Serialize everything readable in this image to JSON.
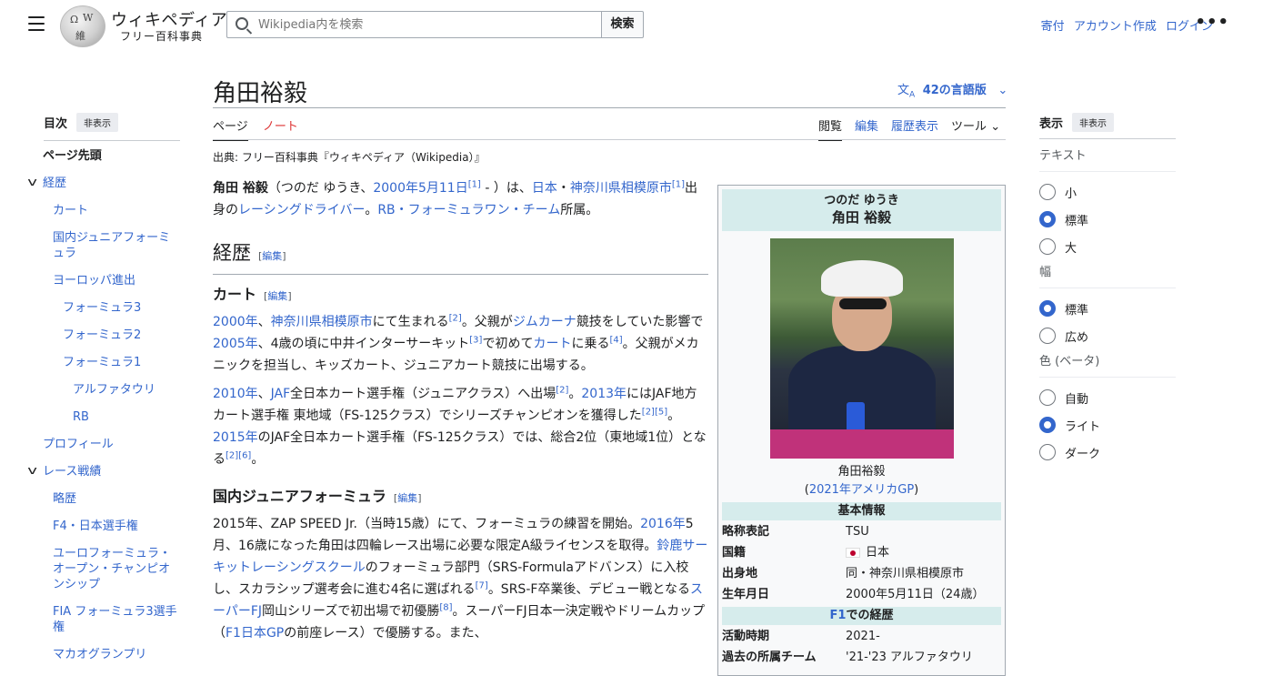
{
  "header": {
    "site_title": "ウィキペディア",
    "site_tagline": "フリー百科事典",
    "search_placeholder": "Wikipedia内を検索",
    "search_button": "検索",
    "links": [
      "寄付",
      "アカウント作成",
      "ログイン"
    ],
    "more": "•••"
  },
  "toc": {
    "title": "目次",
    "hide": "非表示",
    "items": [
      {
        "label": "ページ先頭",
        "level": 0,
        "top": true
      },
      {
        "label": "経歴",
        "level": 0,
        "chevron": true
      },
      {
        "label": "カート",
        "level": 1
      },
      {
        "label": "国内ジュニアフォーミュラ",
        "level": 1
      },
      {
        "label": "ヨーロッパ進出",
        "level": 1
      },
      {
        "label": "フォーミュラ3",
        "level": 2
      },
      {
        "label": "フォーミュラ2",
        "level": 2
      },
      {
        "label": "フォーミュラ1",
        "level": 2
      },
      {
        "label": "アルファタウリ",
        "level": 3
      },
      {
        "label": "RB",
        "level": 3
      },
      {
        "label": "プロフィール",
        "level": 0
      },
      {
        "label": "レース戦績",
        "level": 0,
        "chevron": true
      },
      {
        "label": "略歴",
        "level": 1
      },
      {
        "label": "F4・日本選手権",
        "level": 1
      },
      {
        "label": "ユーロフォーミュラ・オープン・チャンピオンシップ",
        "level": 1
      },
      {
        "label": "FIA フォーミュラ3選手権",
        "level": 1
      },
      {
        "label": "マカオグランプリ",
        "level": 1
      }
    ]
  },
  "page": {
    "title": "角田裕毅",
    "languages": "42の言語版",
    "tab_page": "ページ",
    "tab_talk": "ノート",
    "tab_read": "閲覧",
    "tab_edit": "編集",
    "tab_history": "履歴表示",
    "tab_tools": "ツール",
    "from": "出典: フリー百科事典『ウィキペディア（Wikipedia）』"
  },
  "article": {
    "edit": "編集",
    "h_career": "経歴",
    "h_kart": "カート",
    "h_junior": "国内ジュニアフォーミュラ"
  },
  "infobox": {
    "reading": "つのだ ゆうき",
    "name": "角田 裕毅",
    "caption_name": "角田裕毅",
    "caption_event": "2021年アメリカGP",
    "section_basic": "基本情報",
    "rows_basic": [
      {
        "k": "略称表記",
        "v": "TSU"
      },
      {
        "k": "国籍",
        "v": "日本",
        "flag": true
      },
      {
        "k": "出身地",
        "v": "同・神奈川県相模原市"
      },
      {
        "k": "生年月日",
        "v": "2000年5月11日（24歳）"
      }
    ],
    "section_f1": "での経歴",
    "section_f1_link": "F1",
    "rows_f1": [
      {
        "k": "活動時期",
        "v": "2021-"
      },
      {
        "k": "過去の所属チーム",
        "v": "'21-'23 アルファタウリ"
      }
    ]
  },
  "appearance": {
    "title": "表示",
    "hide": "非表示",
    "text_label": "テキスト",
    "text_options": [
      "小",
      "標準",
      "大"
    ],
    "text_selected": 1,
    "width_label": "幅",
    "width_options": [
      "標準",
      "広め"
    ],
    "width_selected": 0,
    "color_label": "色 (ベータ)",
    "color_options": [
      "自動",
      "ライト",
      "ダーク"
    ],
    "color_selected": 1
  },
  "colors": {
    "link": "#3366cc",
    "infobox_header": "#d6ecec"
  }
}
